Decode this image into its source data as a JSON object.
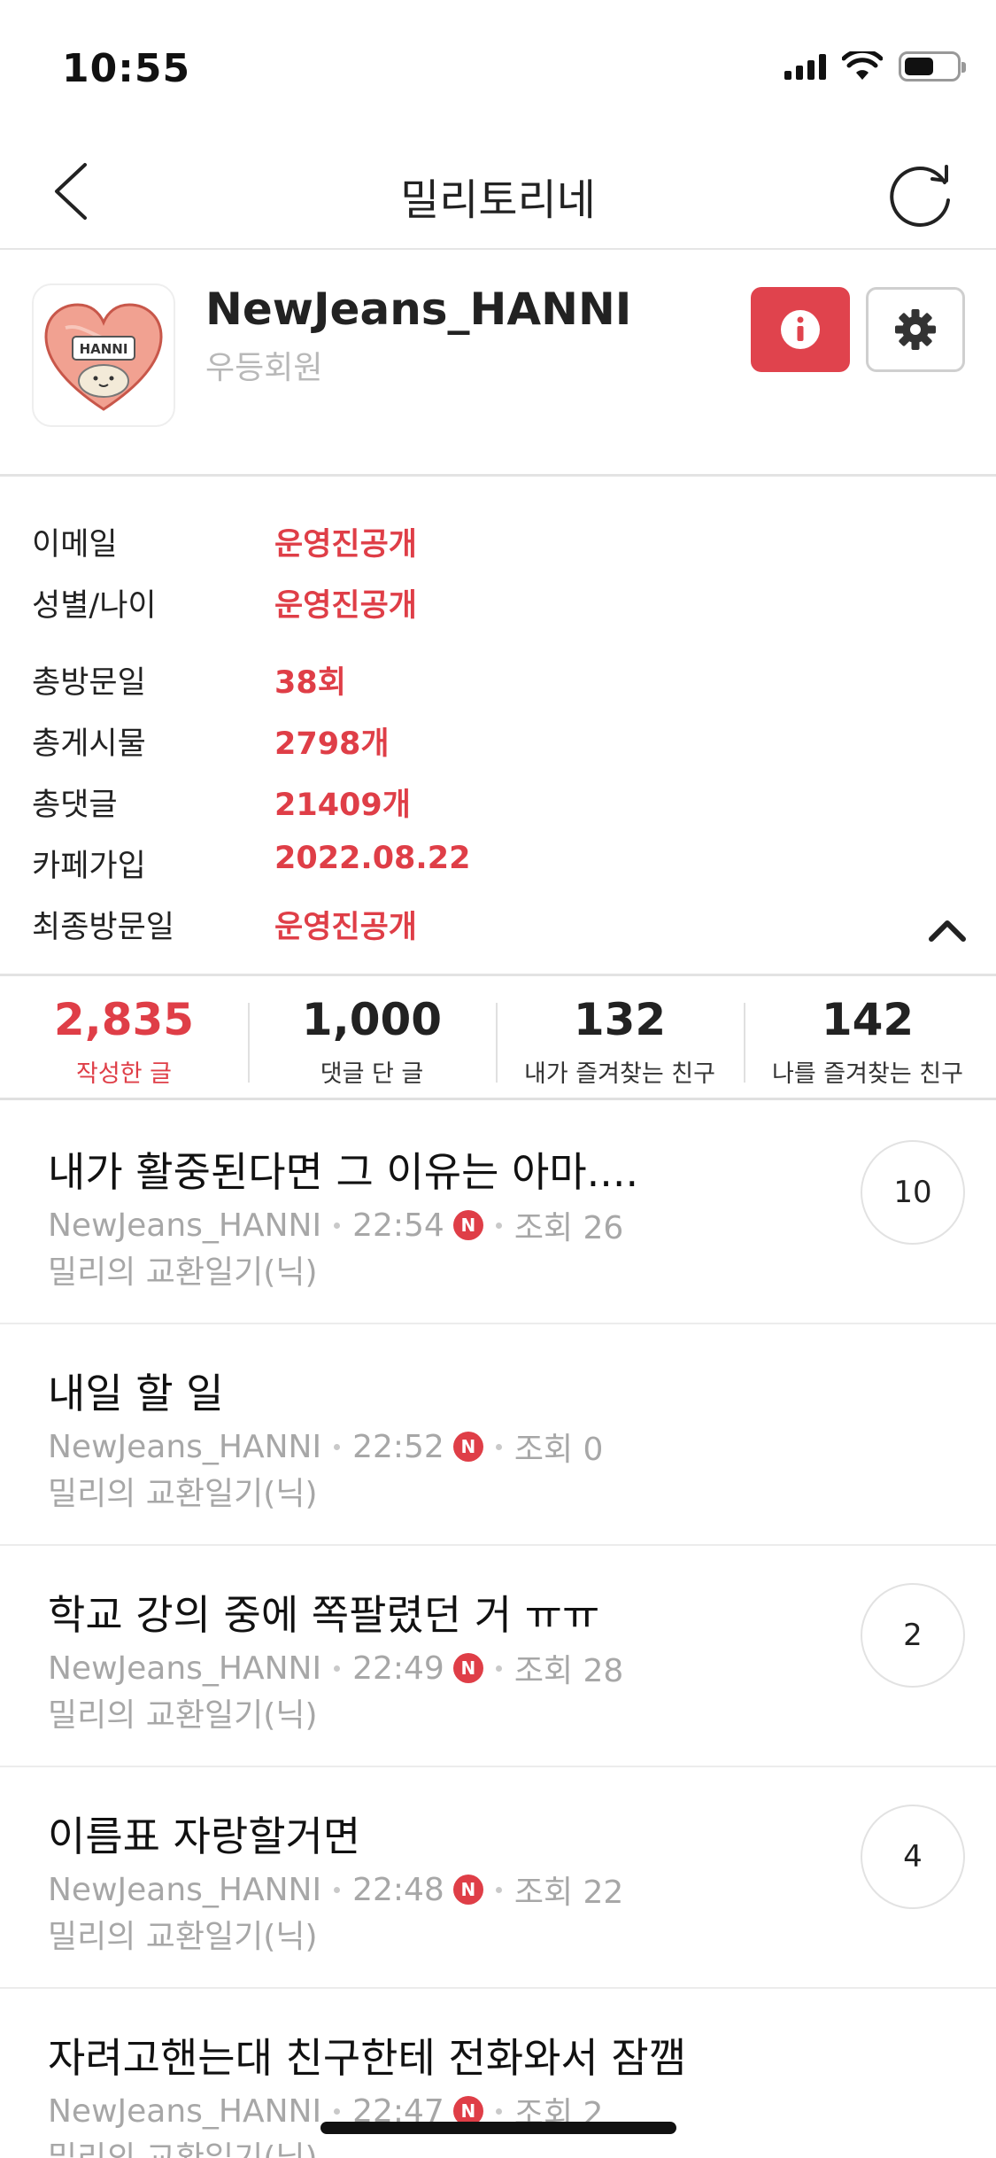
{
  "status_bar": {
    "time": "10:55"
  },
  "nav": {
    "title": "밀리토리네"
  },
  "profile": {
    "name": "NewJeans_HANNI",
    "grade": "우등회원",
    "avatar_text": "HANNI"
  },
  "info": [
    {
      "label": "이메일",
      "value": "운영진공개"
    },
    {
      "label": "성별/나이",
      "value": "운영진공개"
    },
    {
      "label": "총방문일",
      "value": "38회"
    },
    {
      "label": "총게시물",
      "value": "2798개"
    },
    {
      "label": "총댓글",
      "value": "21409개"
    },
    {
      "label": "카페가입",
      "value": "2022.08.22"
    },
    {
      "label": "최종방문일",
      "value": "운영진공개"
    }
  ],
  "stats": [
    {
      "value": "2,835",
      "label": "작성한 글"
    },
    {
      "value": "1,000",
      "label": "댓글 단 글"
    },
    {
      "value": "132",
      "label": "내가 즐겨찾는 친구"
    },
    {
      "value": "142",
      "label": "나를 즐겨찾는 친구"
    }
  ],
  "posts": [
    {
      "title": "내가 활중된다면 그 이유는 아마....",
      "author": "NewJeans_HANNI",
      "time": "22:54",
      "badge": "N",
      "views": "조회 26",
      "board": "밀리의 교환일기(닉)",
      "comments": "10"
    },
    {
      "title": "내일 할 일",
      "author": "NewJeans_HANNI",
      "time": "22:52",
      "badge": "N",
      "views": "조회 0",
      "board": "밀리의 교환일기(닉)",
      "comments": ""
    },
    {
      "title": "학교 강의 중에 쪽팔렸던 거 ㅠㅠ",
      "author": "NewJeans_HANNI",
      "time": "22:49",
      "badge": "N",
      "views": "조회 28",
      "board": "밀리의 교환일기(닉)",
      "comments": "2"
    },
    {
      "title": "이름표 자랑할거면",
      "author": "NewJeans_HANNI",
      "time": "22:48",
      "badge": "N",
      "views": "조회 22",
      "board": "밀리의 교환일기(닉)",
      "comments": "4"
    },
    {
      "title": "자려고핸는대 친구한테 전화와서 잠깸",
      "author": "NewJeans_HANNI",
      "time": "22:47",
      "badge": "N",
      "views": "조회 2",
      "board": "밀리의 교환일기(닉)",
      "comments": ""
    }
  ],
  "colors": {
    "accent": "#df3e47",
    "muted": "#a7a7a7",
    "divider": "#e3e3e3"
  },
  "icons": {
    "back": "chevron-left-icon",
    "refresh": "refresh-icon",
    "info": "info-icon",
    "settings": "gear-icon",
    "collapse": "chevron-up-icon"
  }
}
